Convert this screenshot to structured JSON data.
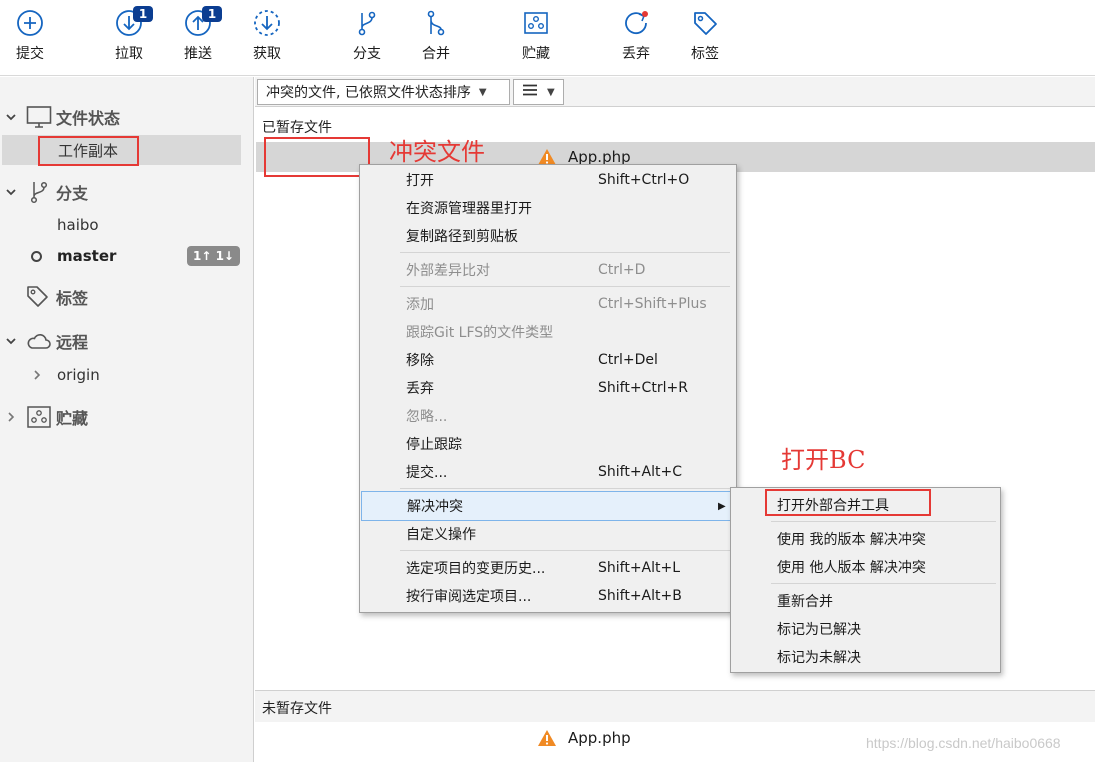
{
  "toolbar": {
    "items": [
      {
        "label": "提交",
        "icon": "plus-circle-icon",
        "badge": ""
      },
      {
        "label": "拉取",
        "icon": "pull-arrow-icon",
        "badge": "1"
      },
      {
        "label": "推送",
        "icon": "push-arrow-icon",
        "badge": "1"
      },
      {
        "label": "获取",
        "icon": "fetch-dashed-icon",
        "badge": ""
      },
      {
        "label": "分支",
        "icon": "branch-icon",
        "badge": ""
      },
      {
        "label": "合并",
        "icon": "merge-icon",
        "badge": ""
      },
      {
        "label": "贮藏",
        "icon": "stash-icon",
        "badge": ""
      },
      {
        "label": "丢弃",
        "icon": "discard-icon",
        "badge": ""
      },
      {
        "label": "标签",
        "icon": "tag-icon",
        "badge": ""
      }
    ]
  },
  "sidebar": {
    "file_status": {
      "header": "文件状态",
      "items": [
        "工作副本"
      ]
    },
    "branches": {
      "header": "分支",
      "items": [
        "haibo",
        "master"
      ],
      "current": "master",
      "current_badge": "1↑ 1↓"
    },
    "tags": {
      "header": "标签"
    },
    "remotes": {
      "header": "远程",
      "items": [
        "origin"
      ]
    },
    "stashes": {
      "header": "贮藏"
    }
  },
  "filter": {
    "sort_dropdown": "冲突的文件, 已依照文件状态排序",
    "view_dropdown": "list-icon"
  },
  "staged": {
    "title": "已暂存文件",
    "files": [
      "App.php"
    ]
  },
  "unstaged": {
    "title": "未暂存文件",
    "files": [
      "App.php"
    ]
  },
  "annotations": {
    "conflict_file": "冲突文件",
    "open_bc": "打开BC"
  },
  "context_menu": {
    "items": [
      {
        "label": "打开",
        "shortcut": "Shift+Ctrl+O"
      },
      {
        "label": "在资源管理器里打开",
        "shortcut": ""
      },
      {
        "label": "复制路径到剪贴板",
        "shortcut": ""
      },
      {
        "label": "外部差异比对",
        "shortcut": "Ctrl+D"
      },
      {
        "label": "添加",
        "shortcut": "Ctrl+Shift+Plus"
      },
      {
        "label": "跟踪Git LFS的文件类型",
        "shortcut": ""
      },
      {
        "label": "移除",
        "shortcut": "Ctrl+Del"
      },
      {
        "label": "丢弃",
        "shortcut": "Shift+Ctrl+R"
      },
      {
        "label": "忽略...",
        "shortcut": ""
      },
      {
        "label": "停止跟踪",
        "shortcut": ""
      },
      {
        "label": "提交...",
        "shortcut": "Shift+Alt+C"
      },
      {
        "label": "解决冲突",
        "shortcut": ""
      },
      {
        "label": "自定义操作",
        "shortcut": ""
      },
      {
        "label": "选定项目的变更历史...",
        "shortcut": "Shift+Alt+L"
      },
      {
        "label": "按行审阅选定项目...",
        "shortcut": "Shift+Alt+B"
      }
    ]
  },
  "submenu": {
    "items": [
      "打开外部合并工具",
      "使用 我的版本 解决冲突",
      "使用 他人版本 解决冲突",
      "重新合并",
      "标记为已解决",
      "标记为未解决"
    ]
  },
  "watermark": "https://blog.csdn.net/haibo0668",
  "colors": {
    "badge": "#0b3d91",
    "annotation": "#e53935",
    "warning": "#f08a24",
    "highlight": "#e5f0fb"
  }
}
